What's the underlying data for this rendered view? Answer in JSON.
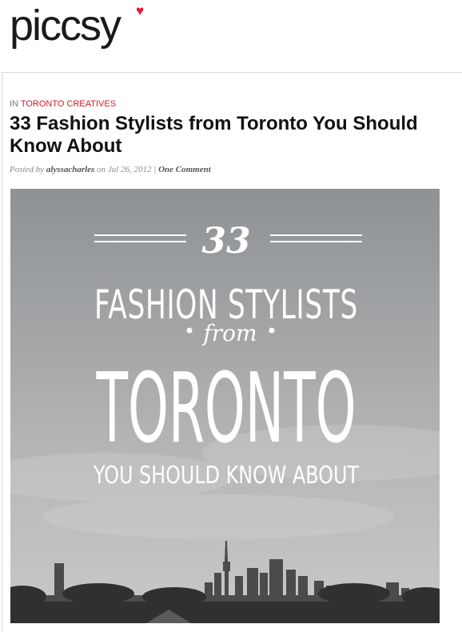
{
  "site": {
    "logo_text": "piccsy",
    "logo_mark": "♥"
  },
  "post": {
    "category_prefix": "IN",
    "category": "TORONTO CREATIVES",
    "title": "33 Fashion Stylists from Toronto You Should Know About",
    "posted_by_label": "Posted by",
    "author": "alyssacharles",
    "date_prefix": "on",
    "date": "Jul 26, 2012",
    "separator": "|",
    "comments": "One Comment"
  },
  "hero": {
    "number": "33",
    "line1": "FASHION STYLISTS",
    "connector": "from",
    "city": "TORONTO",
    "line3": "YOU SHOULD KNOW ABOUT"
  },
  "colors": {
    "accent": "#cc1b28",
    "heart": "#e01b2f"
  }
}
